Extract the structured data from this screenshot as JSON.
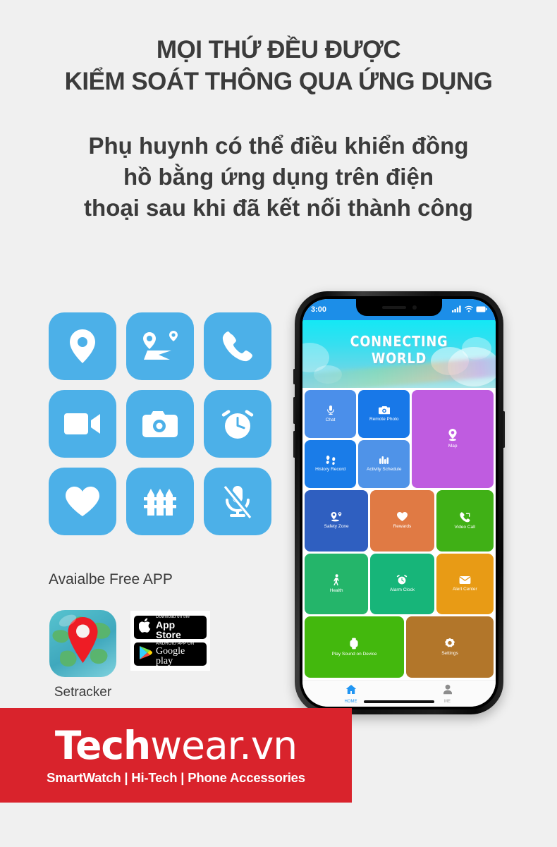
{
  "headline": {
    "line1": "MỌI THỨ ĐỀU ĐƯỢC",
    "line2": "KIỂM SOÁT THÔNG QUA ỨNG DỤNG"
  },
  "subhead": {
    "line1": "Phụ huynh có thể điều khiển đồng",
    "line2": "hồ bằng ứng dụng trên điện",
    "line3": "thoại sau khi đã kết nối thành công"
  },
  "feature_icons": [
    {
      "name": "location-pin-icon"
    },
    {
      "name": "route-map-icon"
    },
    {
      "name": "phone-call-icon"
    },
    {
      "name": "video-camera-icon"
    },
    {
      "name": "camera-icon"
    },
    {
      "name": "alarm-clock-icon"
    },
    {
      "name": "heart-icon"
    },
    {
      "name": "fence-icon"
    },
    {
      "name": "microphone-muted-icon"
    }
  ],
  "app_promo": {
    "label": "Avaialbe Free APP",
    "app_name": "Setracker",
    "badges": [
      {
        "small": "Download on the",
        "big": "App Store",
        "icon": "apple-icon"
      },
      {
        "small": "ANDROID APP ON",
        "big": "Google play",
        "icon": "google-play-icon"
      }
    ]
  },
  "phone": {
    "status_bar": {
      "time": "3:00",
      "icons": [
        "signal-icon",
        "wifi-icon",
        "battery-icon"
      ]
    },
    "banner": {
      "line1": "CONNECTING",
      "line2": "WORLD"
    },
    "tiles": [
      {
        "label": "Chat",
        "icon": "microphone-icon",
        "color": "#4b8fea"
      },
      {
        "label": "Remote Photo",
        "icon": "camera-icon",
        "color": "#1878e8"
      },
      {
        "label": "Map",
        "icon": "map-pin-icon",
        "color": "#bf5ce0"
      },
      {
        "label": "History Record",
        "icon": "footsteps-icon",
        "color": "#1a7ce8"
      },
      {
        "label": "Activity Schedule",
        "icon": "bar-chart-icon",
        "color": "#4f93e8"
      },
      {
        "label": "Safety Zone",
        "icon": "geo-fence-icon",
        "color": "#2f5fc0"
      },
      {
        "label": "Rewards",
        "icon": "heart-icon",
        "color": "#e07a44"
      },
      {
        "label": "Video Call",
        "icon": "phone-call-icon",
        "color": "#40b016"
      },
      {
        "label": "Health",
        "icon": "walking-icon",
        "color": "#24b56a"
      },
      {
        "label": "Alarm Clock",
        "icon": "alarm-clock-icon",
        "color": "#17b579"
      },
      {
        "label": "Alert Center",
        "icon": "envelope-icon",
        "color": "#e89b15"
      },
      {
        "label": "Play Sound on Device",
        "icon": "watch-icon",
        "color": "#43b80d"
      },
      {
        "label": "Settings",
        "icon": "gear-icon",
        "color": "#b2762a"
      }
    ],
    "nav": [
      {
        "label": "HOME",
        "icon": "home-icon",
        "color": "#2196f3",
        "active": true
      },
      {
        "label": "ME",
        "icon": "person-icon",
        "color": "#8d8d8d",
        "active": false
      }
    ]
  },
  "footer_banner": {
    "brand_bold": "Tech",
    "brand_light": "wear.vn",
    "tagline": "SmartWatch | Hi-Tech | Phone Accessories",
    "background": "#d9232c"
  },
  "theme": {
    "page_background": "#f0f0f0",
    "icon_blue": "#4cb0e8",
    "text_dark": "#3b3b3b"
  }
}
